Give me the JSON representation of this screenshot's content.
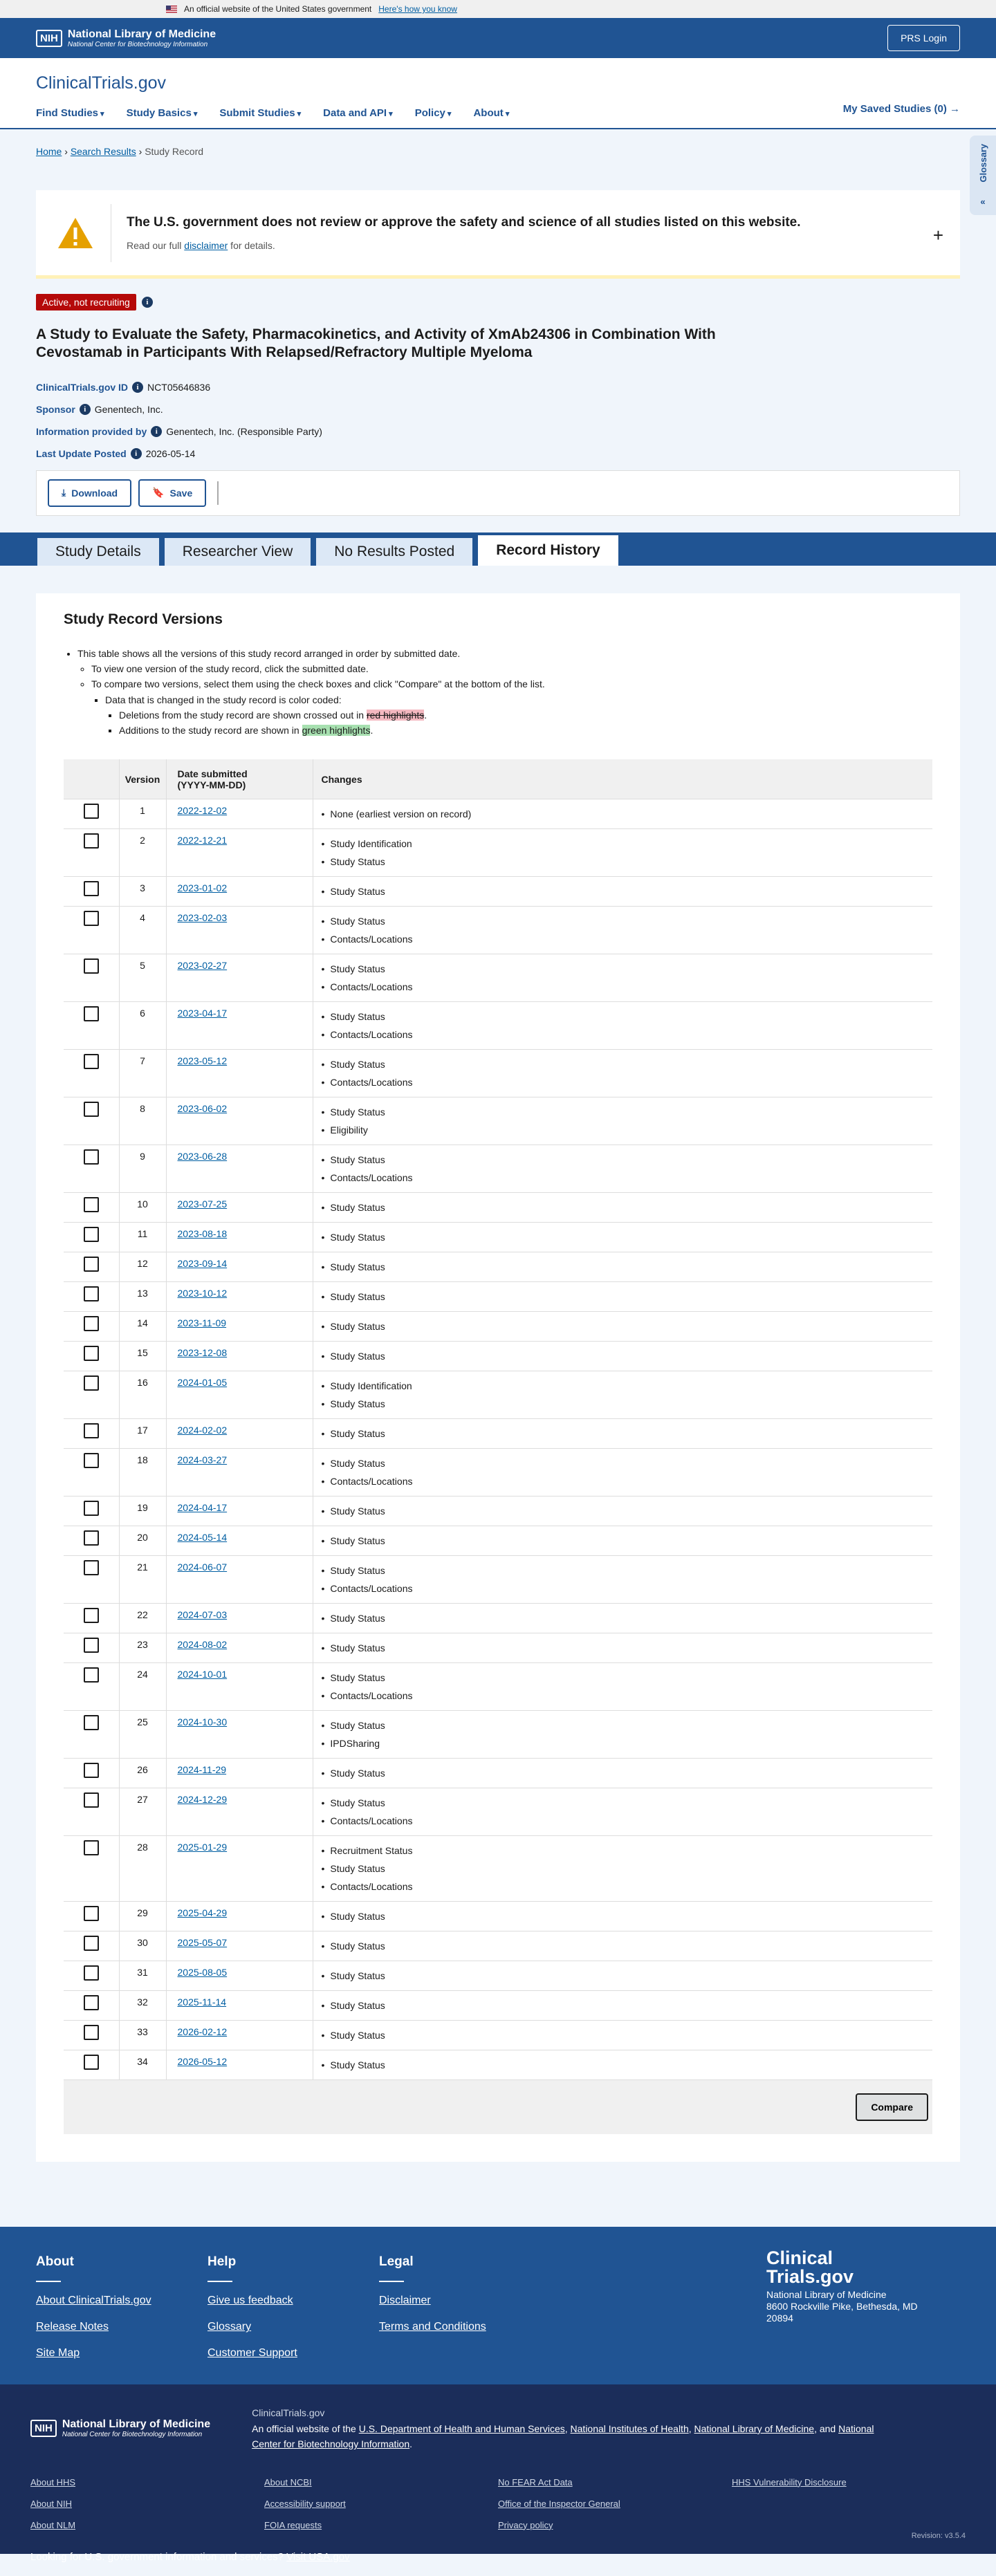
{
  "banner": {
    "text": "An official website of the United States government",
    "link": "Here's how you know"
  },
  "nih": {
    "box": "NIH",
    "title": "National Library of Medicine",
    "subtitle": "National Center for Biotechnology Information",
    "prs": "PRS Login"
  },
  "site": {
    "logo_a": "Clinical",
    "logo_b": "Trials.gov",
    "nav": [
      "Find Studies",
      "Study Basics",
      "Submit Studies",
      "Data and API",
      "Policy",
      "About"
    ],
    "saved": "My Saved Studies (0)"
  },
  "glossary": "Glossary",
  "breadcrumb": {
    "home": "Home",
    "search": "Search Results",
    "current": "Study Record"
  },
  "notice": {
    "title": "The U.S. government does not review or approve the safety and science of all studies listed on this website.",
    "pre": "Read our full ",
    "link": "disclaimer",
    "post": " for details."
  },
  "study": {
    "status": "Active, not recruiting",
    "title": "A Study to Evaluate the Safety, Pharmacokinetics, and Activity of XmAb24306 in Combination With Cevostamab in Participants With Relapsed/Refractory Multiple Myeloma",
    "id_label": "ClinicalTrials.gov ID",
    "id": "NCT05646836",
    "sponsor_label": "Sponsor",
    "sponsor": "Genentech, Inc.",
    "provided_label": "Information provided by",
    "provided": "Genentech, Inc. (Responsible Party)",
    "updated_label": "Last Update Posted",
    "updated": "2026-05-14"
  },
  "actions": {
    "download": "Download",
    "save": "Save"
  },
  "tabs": [
    "Study Details",
    "Researcher View",
    "No Results Posted",
    "Record History"
  ],
  "history": {
    "title": "Study Record Versions",
    "b1": "This table shows all the versions of this study record arranged in order by submitted date.",
    "b2": "To view one version of the study record, click the submitted date.",
    "b3": "To compare two versions, select them using the check boxes and click \"Compare\" at the bottom of the list.",
    "b4": "Data that is changed in the study record is color coded:",
    "b5a": "Deletions from the study record are shown crossed out in ",
    "b5b": "red highlights",
    "b6a": "Additions to the study record are shown in ",
    "b6b": "green highlights",
    "col_version": "Version",
    "col_date_1": "Date submitted",
    "col_date_2": "(YYYY-MM-DD)",
    "col_changes": "Changes",
    "compare": "Compare",
    "rows": [
      {
        "v": "1",
        "d": "2022-12-02",
        "c": [
          "None (earliest version on record)"
        ]
      },
      {
        "v": "2",
        "d": "2022-12-21",
        "c": [
          "Study Identification",
          "Study Status"
        ]
      },
      {
        "v": "3",
        "d": "2023-01-02",
        "c": [
          "Study Status"
        ]
      },
      {
        "v": "4",
        "d": "2023-02-03",
        "c": [
          "Study Status",
          "Contacts/Locations"
        ]
      },
      {
        "v": "5",
        "d": "2023-02-27",
        "c": [
          "Study Status",
          "Contacts/Locations"
        ]
      },
      {
        "v": "6",
        "d": "2023-04-17",
        "c": [
          "Study Status",
          "Contacts/Locations"
        ]
      },
      {
        "v": "7",
        "d": "2023-05-12",
        "c": [
          "Study Status",
          "Contacts/Locations"
        ]
      },
      {
        "v": "8",
        "d": "2023-06-02",
        "c": [
          "Study Status",
          "Eligibility"
        ]
      },
      {
        "v": "9",
        "d": "2023-06-28",
        "c": [
          "Study Status",
          "Contacts/Locations"
        ]
      },
      {
        "v": "10",
        "d": "2023-07-25",
        "c": [
          "Study Status"
        ]
      },
      {
        "v": "11",
        "d": "2023-08-18",
        "c": [
          "Study Status"
        ]
      },
      {
        "v": "12",
        "d": "2023-09-14",
        "c": [
          "Study Status"
        ]
      },
      {
        "v": "13",
        "d": "2023-10-12",
        "c": [
          "Study Status"
        ]
      },
      {
        "v": "14",
        "d": "2023-11-09",
        "c": [
          "Study Status"
        ]
      },
      {
        "v": "15",
        "d": "2023-12-08",
        "c": [
          "Study Status"
        ]
      },
      {
        "v": "16",
        "d": "2024-01-05",
        "c": [
          "Study Identification",
          "Study Status"
        ]
      },
      {
        "v": "17",
        "d": "2024-02-02",
        "c": [
          "Study Status"
        ]
      },
      {
        "v": "18",
        "d": "2024-03-27",
        "c": [
          "Study Status",
          "Contacts/Locations"
        ]
      },
      {
        "v": "19",
        "d": "2024-04-17",
        "c": [
          "Study Status"
        ]
      },
      {
        "v": "20",
        "d": "2024-05-14",
        "c": [
          "Study Status"
        ]
      },
      {
        "v": "21",
        "d": "2024-06-07",
        "c": [
          "Study Status",
          "Contacts/Locations"
        ]
      },
      {
        "v": "22",
        "d": "2024-07-03",
        "c": [
          "Study Status"
        ]
      },
      {
        "v": "23",
        "d": "2024-08-02",
        "c": [
          "Study Status"
        ]
      },
      {
        "v": "24",
        "d": "2024-10-01",
        "c": [
          "Study Status",
          "Contacts/Locations"
        ]
      },
      {
        "v": "25",
        "d": "2024-10-30",
        "c": [
          "Study Status",
          "IPDSharing"
        ]
      },
      {
        "v": "26",
        "d": "2024-11-29",
        "c": [
          "Study Status"
        ]
      },
      {
        "v": "27",
        "d": "2024-12-29",
        "c": [
          "Study Status",
          "Contacts/Locations"
        ]
      },
      {
        "v": "28",
        "d": "2025-01-29",
        "c": [
          "Recruitment Status",
          "Study Status",
          "Contacts/Locations"
        ]
      },
      {
        "v": "29",
        "d": "2025-04-29",
        "c": [
          "Study Status"
        ]
      },
      {
        "v": "30",
        "d": "2025-05-07",
        "c": [
          "Study Status"
        ]
      },
      {
        "v": "31",
        "d": "2025-08-05",
        "c": [
          "Study Status"
        ]
      },
      {
        "v": "32",
        "d": "2025-11-14",
        "c": [
          "Study Status"
        ]
      },
      {
        "v": "33",
        "d": "2026-02-12",
        "c": [
          "Study Status"
        ]
      },
      {
        "v": "34",
        "d": "2026-05-12",
        "c": [
          "Study Status"
        ]
      }
    ]
  },
  "footer": {
    "cols": [
      {
        "h": "About",
        "links": [
          "About ClinicalTrials.gov",
          "Release Notes",
          "Site Map"
        ]
      },
      {
        "h": "Help",
        "links": [
          "Give us feedback",
          "Glossary",
          "Customer Support"
        ]
      },
      {
        "h": "Legal",
        "links": [
          "Disclaimer",
          "Terms and Conditions"
        ]
      }
    ],
    "logo_1": "Clinical",
    "logo_2": "Trials.gov",
    "org": "National Library of Medicine",
    "addr1": "8600 Rockville Pike, Bethesda, MD",
    "addr2": "20894"
  },
  "footer2": {
    "site": "ClinicalTrials.gov",
    "pre": "An official website of the ",
    "l1": "U.S. Department of Health and Human Services",
    "l2": "National Institutes of Health",
    "l3": "National Library of Medicine",
    "and": ", and ",
    "l4": "National Center for Biotechnology Information",
    "links": [
      [
        "About HHS",
        "About NIH",
        "About NLM"
      ],
      [
        "About NCBI",
        "Accessibility support",
        "FOIA requests"
      ],
      [
        "No FEAR Act Data",
        "Office of the Inspector General",
        "Privacy policy"
      ],
      [
        "HHS Vulnerability Disclosure"
      ]
    ],
    "usa_pre": "Looking for U.S. government information and services?",
    "usa_link": "Visit USA.gov",
    "revision": "Revision: v3.5.4"
  }
}
